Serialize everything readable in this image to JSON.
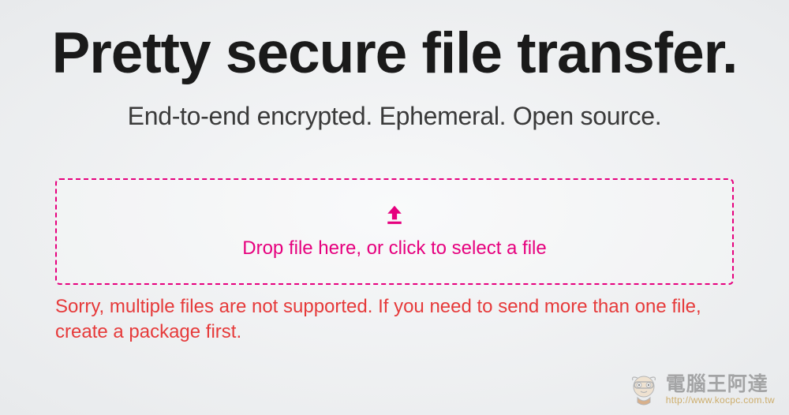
{
  "header": {
    "title": "Pretty secure file transfer.",
    "subtitle": "End-to-end encrypted. Ephemeral. Open source."
  },
  "dropzone": {
    "label": "Drop file here, or click to select a file"
  },
  "error": {
    "message": "Sorry, multiple files are not supported. If you need to send more than one file, create a package first."
  },
  "watermark": {
    "name": "電腦王阿達",
    "url": "http://www.kocpc.com.tw"
  },
  "colors": {
    "accent": "#e6007e",
    "error": "#e63a3a"
  }
}
